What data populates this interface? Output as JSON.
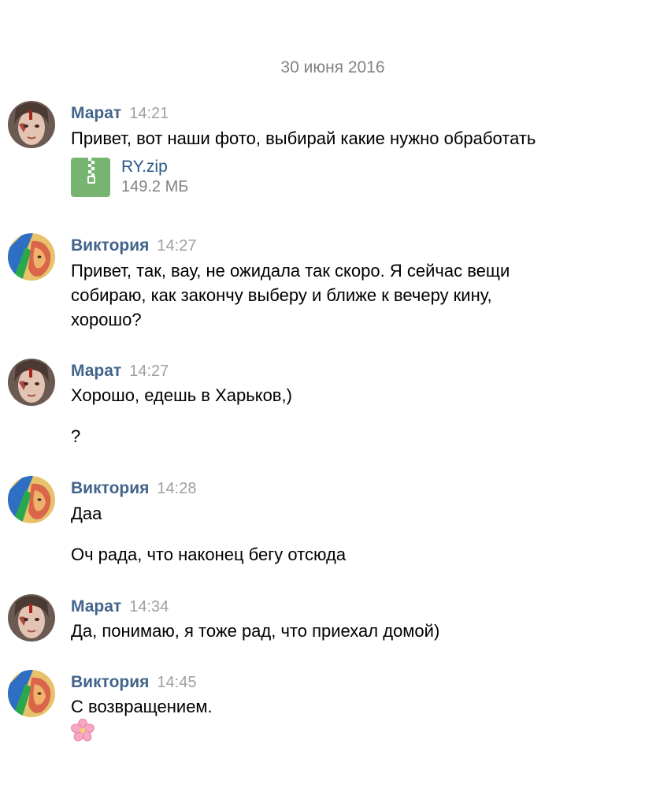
{
  "date_separator": "30 июня 2016",
  "colors": {
    "author": "#42648b",
    "time": "#a0a0a0",
    "link": "#2a5885",
    "date": "#828282",
    "zip_icon": "#77b46f"
  },
  "messages": [
    {
      "author": "Марат",
      "time": "14:21",
      "lines": [
        "Привет, вот наши фото, выбирай какие нужно обработать"
      ],
      "attachment": {
        "icon": "zip-archive-icon",
        "name": "RY.zip",
        "size": "149.2 МБ"
      }
    },
    {
      "author": "Виктория",
      "time": "14:27",
      "lines": [
        "Привет, так, вау, не ожидала так скоро. Я сейчас вещи",
        "собираю, как закончу выберу и ближе к вечеру кину,",
        "хорошо?"
      ]
    },
    {
      "author": "Марат",
      "time": "14:27",
      "lines": [
        "Хорошо, едешь в Харьков,)",
        "?"
      ]
    },
    {
      "author": "Виктория",
      "time": "14:28",
      "lines": [
        "Даа",
        "Оч рада, что наконец бегу отсюда"
      ]
    },
    {
      "author": "Марат",
      "time": "14:34",
      "lines": [
        "Да, понимаю, я тоже рад, что приехал домой)"
      ]
    },
    {
      "author": "Виктория",
      "time": "14:45",
      "lines": [
        "С возвращением."
      ],
      "emoji": "cherry-blossom-icon"
    }
  ]
}
